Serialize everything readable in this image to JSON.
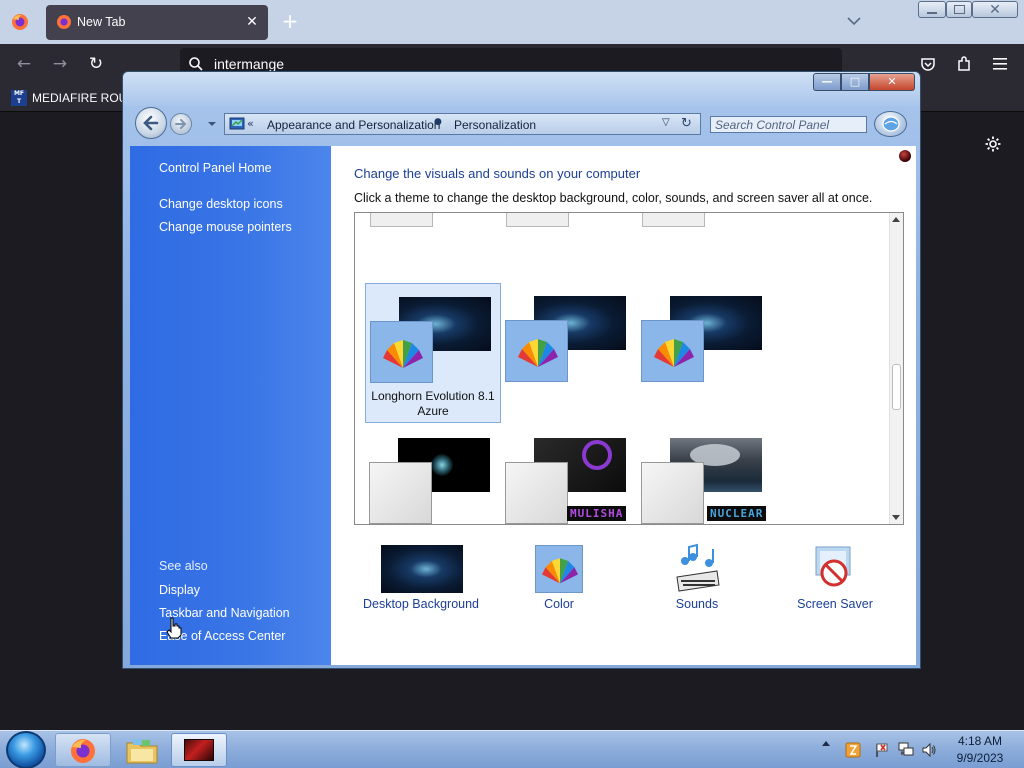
{
  "browser": {
    "tab_title": "New Tab",
    "url_text": "intermange",
    "bookmark_icon_text": "MF\nT",
    "bookmark_label": "MEDIAFIRE ROUL"
  },
  "window": {
    "breadcrumb_sep": "«",
    "breadcrumb": [
      "Appearance and Personalization",
      "Personalization"
    ],
    "search_placeholder": "Search Control Panel"
  },
  "sidebar": {
    "home": "Control Panel Home",
    "tasks": [
      "Change desktop icons",
      "Change mouse pointers"
    ],
    "see_also_heading": "See also",
    "see_also": [
      "Display",
      "Taskbar and Navigation",
      "Ease of Access Center"
    ]
  },
  "main": {
    "heading": "Change the visuals and sounds on your computer",
    "description": "Click a theme to change the desktop background, color, sounds, and screen saver all at once.",
    "selected_theme_name": "Longhorn Evolution 8.1 Azure",
    "theme_labels": [
      "MULISHA",
      "NUCLEAR"
    ],
    "options": [
      "Desktop Background",
      "Color",
      "Sounds",
      "Screen Saver"
    ]
  },
  "taskbar": {
    "time": "4:18 AM",
    "date": "9/9/2023"
  },
  "colors": {
    "link": "#1c3f95",
    "sidebar": "#3a76e6",
    "selected_theme": "#dbe9fb"
  }
}
